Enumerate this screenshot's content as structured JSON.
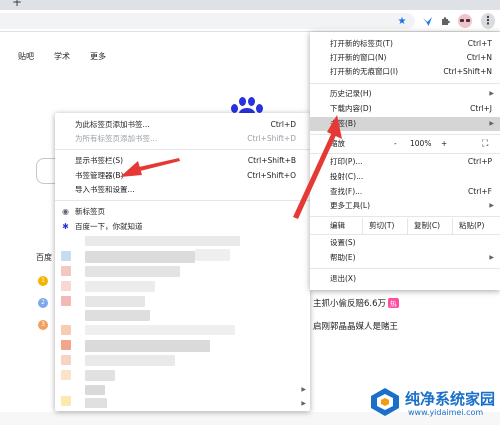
{
  "tabs": {
    "new_tab_symbol": "+"
  },
  "toolbar": {
    "icons": [
      "star-icon",
      "extension-bird-icon",
      "puzzle-icon",
      "avatar",
      "kebab-menu-icon"
    ],
    "accent": "#1a73e8"
  },
  "page": {
    "nav_links": [
      "贴吧",
      "学术",
      "更多"
    ],
    "baidu_label": "百度",
    "hot_items": [
      {
        "text": "主抓小偷反赔6.6万",
        "badge": "热"
      },
      {
        "text": "启刚郭晶晶媒人是赌王",
        "badge": ""
      }
    ],
    "rank_numbers": [
      "1",
      "2",
      "3"
    ],
    "brand_color": "#2932e1"
  },
  "bookmarks_submenu": {
    "items": [
      {
        "label": "为此标签页添加书签...",
        "shortcut": "Ctrl+D",
        "disabled": false
      },
      {
        "label": "为所有标签页添加书签...",
        "shortcut": "Ctrl+Shift+D",
        "disabled": true
      },
      {
        "label": "显示书签栏(S)",
        "shortcut": "Ctrl+Shift+B",
        "disabled": false
      },
      {
        "label": "书签管理器(B)",
        "shortcut": "Ctrl+Shift+O",
        "disabled": false
      },
      {
        "label": "导入书签和设置...",
        "shortcut": "",
        "disabled": false
      },
      {
        "label": "新标签页",
        "shortcut": "",
        "disabled": false
      },
      {
        "label": "百度一下，你就知道",
        "shortcut": "",
        "disabled": false
      }
    ]
  },
  "main_menu": {
    "items": [
      {
        "label": "打开新的标签页(T)",
        "shortcut": "Ctrl+T"
      },
      {
        "label": "打开新的窗口(N)",
        "shortcut": "Ctrl+N"
      },
      {
        "label": "打开新的无痕窗口(I)",
        "shortcut": "Ctrl+Shift+N"
      },
      {
        "label": "历史记录(H)",
        "shortcut": ""
      },
      {
        "label": "下载内容(D)",
        "shortcut": "Ctrl+J"
      },
      {
        "label": "书签(B)",
        "shortcut": ""
      },
      {
        "label": "打印(P)...",
        "shortcut": "Ctrl+P"
      },
      {
        "label": "投射(C)...",
        "shortcut": ""
      },
      {
        "label": "查找(F)...",
        "shortcut": "Ctrl+F"
      },
      {
        "label": "更多工具(L)",
        "shortcut": ""
      },
      {
        "label": "设置(S)",
        "shortcut": ""
      },
      {
        "label": "帮助(E)",
        "shortcut": ""
      },
      {
        "label": "退出(X)",
        "shortcut": ""
      }
    ],
    "zoom": {
      "label": "缩放",
      "minus": "-",
      "value": "100%",
      "plus": "+",
      "fullscreen": "⛶"
    },
    "edit": {
      "label": "编辑",
      "cut": "剪切(T)",
      "copy": "复制(C)",
      "paste": "粘贴(P)"
    }
  },
  "annotation_color": "#e53935",
  "watermark": {
    "title": "纯净系统家园",
    "url": "www.yidaimei.com",
    "color": "#1a6fc9"
  }
}
